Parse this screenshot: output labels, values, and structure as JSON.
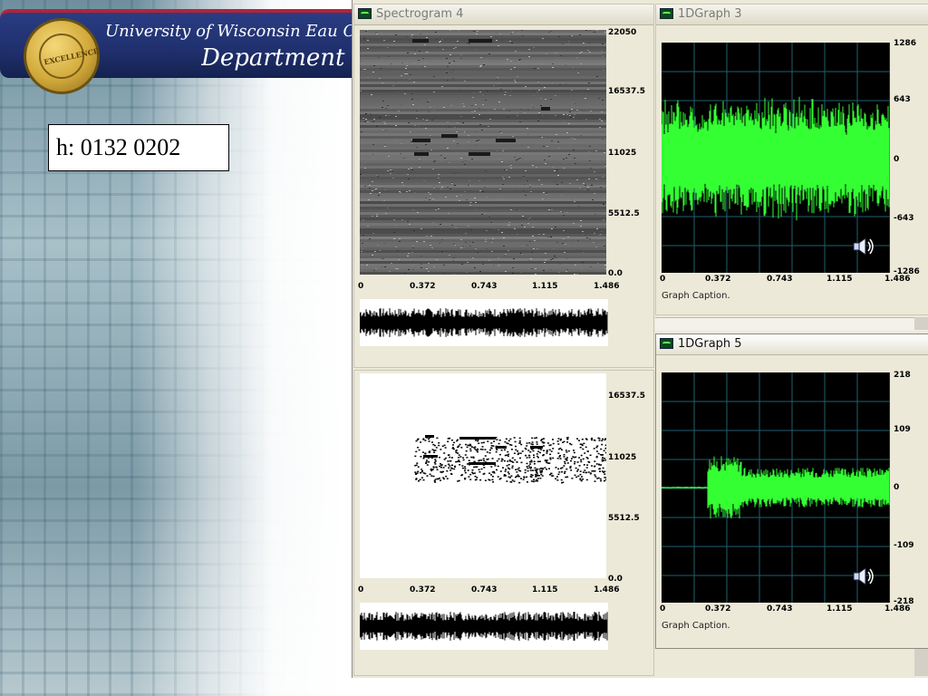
{
  "slide": {
    "banner_title": "University of Wisconsin Eau Claire",
    "banner_subtitle": "Department",
    "seal_text": "EXCELLENCE",
    "hash_label": "h: 0132 0202"
  },
  "windows": {
    "spectrogram": {
      "title": "Spectrogram  4",
      "freq_ticks": [
        "22050",
        "16537.5",
        "11025",
        "5512.5",
        "0.0"
      ],
      "time_ticks": [
        "0",
        "0.372",
        "0.743",
        "1.115",
        "1.486"
      ]
    },
    "filtered": {
      "freq_ticks": [
        "16537.5",
        "11025",
        "5512.5",
        "0.0"
      ],
      "time_ticks": [
        "0",
        "0.372",
        "0.743",
        "1.115",
        "1.486"
      ]
    },
    "graph3": {
      "title": "1DGraph  3",
      "y_ticks": [
        "1286",
        "643",
        "0",
        "-643",
        "-1286"
      ],
      "x_ticks": [
        "0",
        "0.372",
        "0.743",
        "1.115",
        "1.486"
      ],
      "caption": "Graph Caption."
    },
    "graph5": {
      "title": "1DGraph  5",
      "y_ticks": [
        "218",
        "109",
        "0",
        "-109",
        "-218"
      ],
      "x_ticks": [
        "0",
        "0.372",
        "0.743",
        "1.115",
        "1.486"
      ],
      "caption": "Graph Caption."
    }
  },
  "icons": {
    "speaker": "speaker-icon",
    "graph": "graph-window-icon"
  },
  "colors": {
    "waveform_green": "#33ff33",
    "graph_background": "#000000",
    "grid": "#1f5f6f",
    "banner_blue": "#22357a",
    "window_face": "#ece9d8"
  }
}
